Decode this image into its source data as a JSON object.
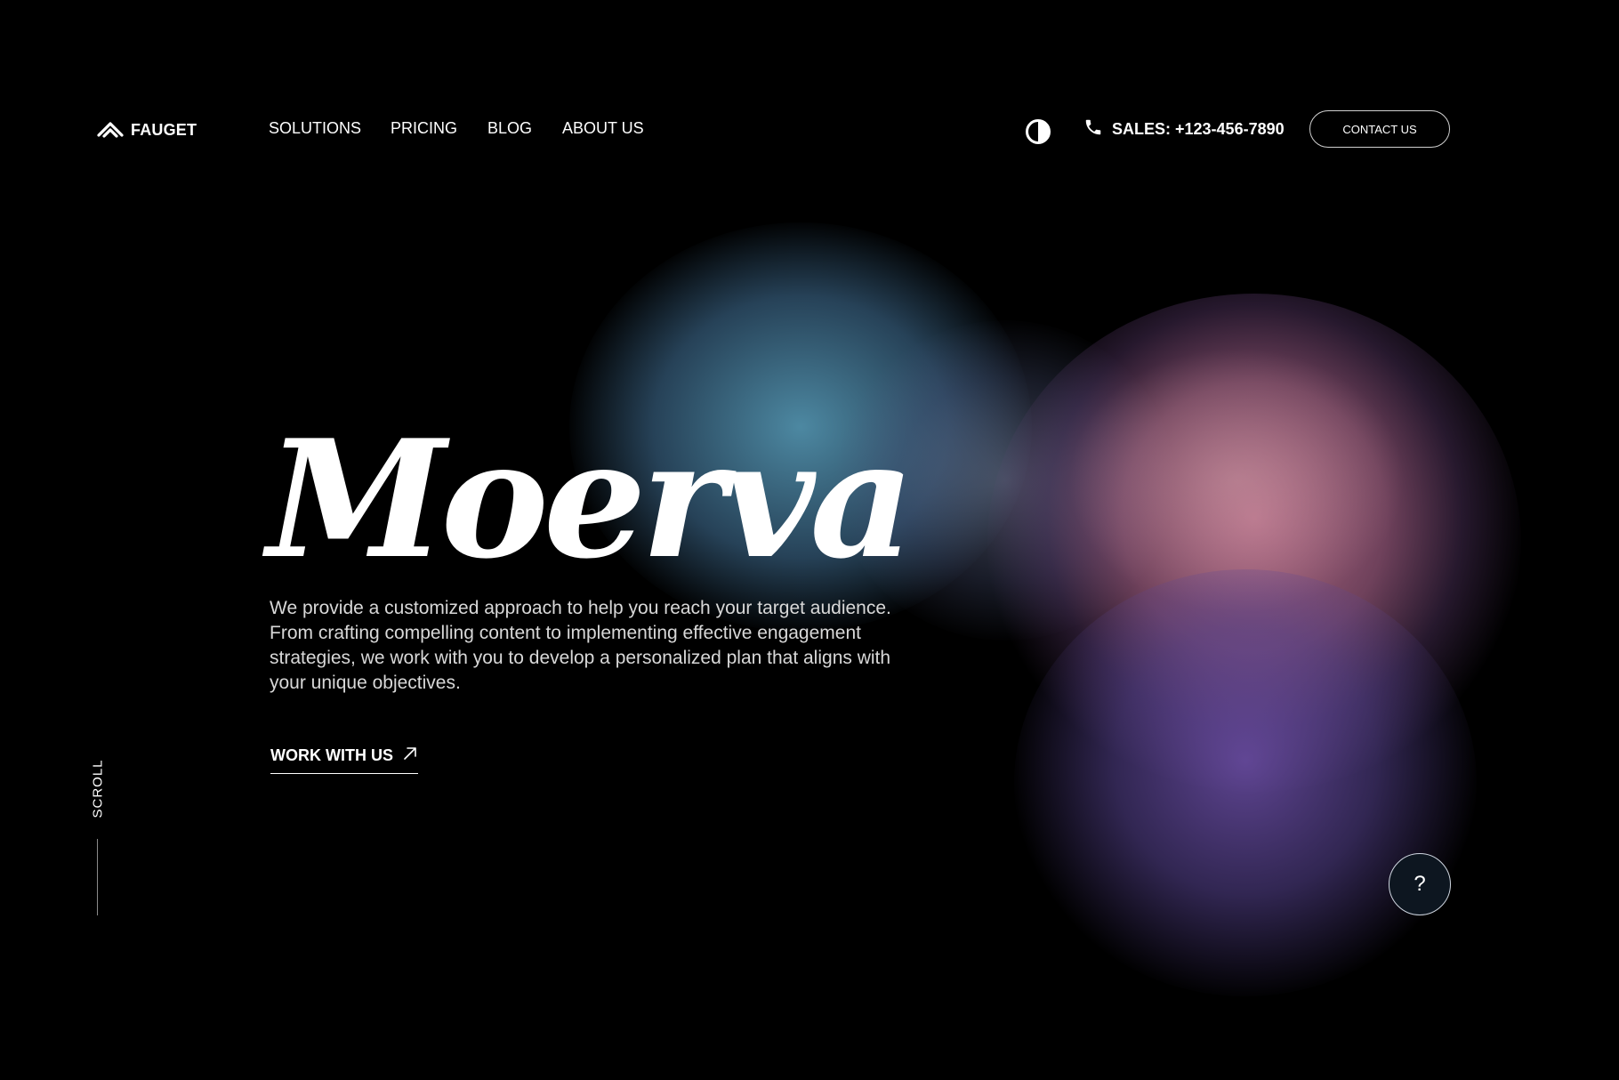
{
  "brand": {
    "name": "FAUGET",
    "logo_icon": "double-chevron-logo-icon"
  },
  "nav": {
    "items": [
      {
        "label": "SOLUTIONS"
      },
      {
        "label": "PRICING"
      },
      {
        "label": "BLOG"
      },
      {
        "label": "ABOUT US"
      }
    ]
  },
  "header": {
    "theme_toggle_icon": "contrast-icon",
    "phone_icon": "phone-icon",
    "sales_text": "SALES: +123-456-7890",
    "contact_label": "CONTACT US"
  },
  "hero": {
    "title": "Moerva",
    "description": "We provide a customized approach to help you reach your target audience. From crafting compelling content to implementing effective engagement strategies, we work with you to develop a personalized plan that aligns with your unique objectives.",
    "cta_label": "WORK WITH US",
    "cta_icon": "arrow-up-right-icon"
  },
  "side": {
    "scroll_label": "SCROLL"
  },
  "help": {
    "label": "?"
  },
  "colors": {
    "background": "#000000",
    "text": "#ffffff",
    "muted_text": "#d8d8d8",
    "blob_teal": "#5aa0be",
    "blob_pink": "#c87896",
    "blob_violet": "#6e50aa",
    "help_bg": "#0d1620"
  }
}
